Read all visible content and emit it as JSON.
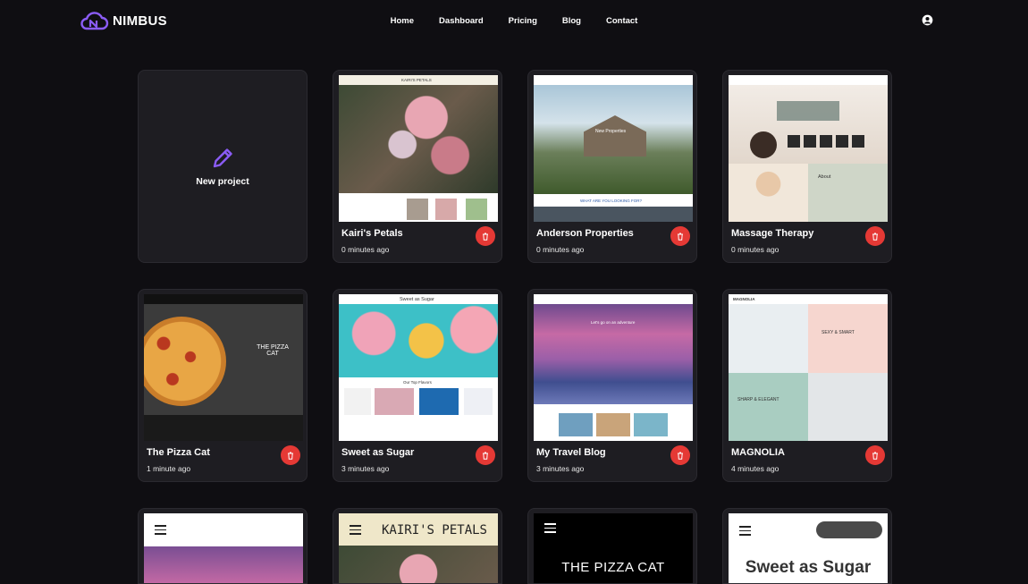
{
  "brand": {
    "name": "NIMBUS",
    "accent": "#8b5cf6"
  },
  "nav": {
    "items": [
      "Home",
      "Dashboard",
      "Pricing",
      "Blog",
      "Contact"
    ]
  },
  "header": {
    "user_icon": "user-circle-icon"
  },
  "new_project": {
    "label": "New project",
    "icon": "pencil-icon"
  },
  "projects": [
    {
      "title": "Kairi's Petals",
      "time": "0 minutes ago",
      "thumb_title": "KAIRI'S PETALS"
    },
    {
      "title": "Anderson Properties",
      "time": "0 minutes ago",
      "thumb_title": "New Properties",
      "thumb_sub": "WHAT ARE YOU LOOKING FOR?"
    },
    {
      "title": "Massage Therapy",
      "time": "0 minutes ago",
      "thumb_title": "About"
    },
    {
      "title": "The Pizza Cat",
      "time": "1 minute ago",
      "thumb_title": "THE PIZZA CAT"
    },
    {
      "title": "Sweet as Sugar",
      "time": "3 minutes ago",
      "thumb_title": "Sweet as Sugar",
      "thumb_sub": "Our Top Flavors"
    },
    {
      "title": "My Travel Blog",
      "time": "3 minutes ago",
      "thumb_title": "Let's go on an adventure"
    },
    {
      "title": "MAGNOLIA",
      "time": "4 minutes ago",
      "thumb_title": "SEXY & SMART",
      "thumb_sub": "SHARP & ELEGANT"
    }
  ],
  "mobile_previews": [
    {
      "title": ""
    },
    {
      "title": "KAIRI'S PETALS"
    },
    {
      "title": "THE PIZZA CAT"
    },
    {
      "title": "Sweet as Sugar"
    }
  ],
  "colors": {
    "background": "#0f0e12",
    "card": "#1e1d22",
    "delete": "#e53935"
  }
}
